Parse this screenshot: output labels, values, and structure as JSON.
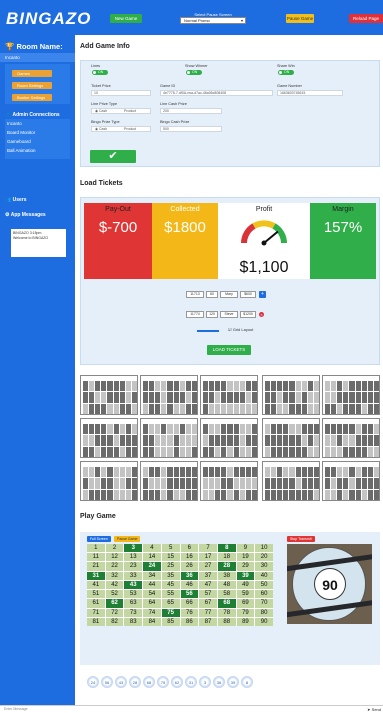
{
  "app": {
    "logo": "BINGAZO"
  },
  "topbar": {
    "new_game": "New Game",
    "pause_label": "Select Pause Screen",
    "pause_value": "Normal Promo",
    "pause_game": "Pause Game",
    "reload": "Reload Page"
  },
  "sidebar": {
    "room_title": "Room Name:",
    "room_name": "Incanto",
    "buttons": [
      "Games",
      "Room Settings",
      "Bunker Settings"
    ],
    "admin_header": "Admin Connections",
    "admin_links": [
      "Incanto",
      "Board Monitor",
      "Gameboard",
      "Ball Animation"
    ],
    "users_header": "Users",
    "messages_header": "App Messages",
    "message_from": "BINGAZO 3:15pm",
    "message_text": "Welcome to BINGAZO"
  },
  "game_info": {
    "title": "Add Game Info",
    "lines_label": "Lines",
    "lines_toggle": "ON",
    "show_winner_label": "Show Winner",
    "show_winner_toggle": "ON",
    "share_win_label": "Share Win",
    "share_win_toggle": "ON",
    "ticket_price_label": "Ticket Price",
    "ticket_price_value": "10",
    "game_id_label": "Game ID",
    "game_id_value": "4e7775-7-df0A-nsa-d7ac-46a06c808408",
    "game_number_label": "Game Number",
    "game_number_value": "1663603745615",
    "line_prize_type_label": "Line Prize Type",
    "line_prize_cash": "Cash",
    "line_prize_product": "Product",
    "line_cash_prize_label": "Line Cash Prize",
    "line_cash_prize_value": "200",
    "bingo_prize_type_label": "Bingo Prize Type",
    "bingo_prize_cash": "Cash",
    "bingo_prize_product": "Product",
    "bingo_cash_prize_label": "Bingo Cash Prize",
    "bingo_cash_prize_value": "500",
    "submit_icon": "checkmark-icon"
  },
  "load_tickets": {
    "title": "Load Tickets",
    "payout_label": "Pay-Out",
    "payout_value": "$-700",
    "collected_label": "Collected",
    "collected_value": "$1800",
    "profit_label": "Profit",
    "profit_value": "$1,100",
    "profit_gauge_fraction": 0.78,
    "margin_label": "Margin",
    "margin_value": "157%",
    "colors": {
      "payout": "#e03535",
      "collected": "#f3b817",
      "margin": "#2fae4a"
    },
    "row1": {
      "start": "11713",
      "count": "60",
      "name": "Mary",
      "amount": "$600"
    },
    "row2": {
      "start": "11774",
      "count": "120",
      "name": "Steve",
      "amount": "$1200"
    },
    "grid_layout_label": "Grid Layout",
    "load_button": "LOAD TICKETS"
  },
  "play": {
    "title": "Play Game",
    "full_screen": "Full Screen",
    "pause_game": "Pause Game",
    "stop_transmit": "Stop Transmit",
    "numbers": [
      1,
      2,
      3,
      4,
      5,
      6,
      7,
      8,
      9,
      10,
      11,
      12,
      13,
      14,
      15,
      16,
      17,
      18,
      19,
      20,
      21,
      22,
      23,
      24,
      25,
      26,
      27,
      28,
      29,
      30,
      31,
      32,
      33,
      34,
      35,
      36,
      37,
      38,
      39,
      40,
      41,
      42,
      43,
      44,
      45,
      46,
      47,
      48,
      49,
      50,
      51,
      52,
      53,
      54,
      55,
      56,
      57,
      58,
      59,
      60,
      61,
      62,
      63,
      64,
      65,
      66,
      67,
      68,
      69,
      70,
      71,
      72,
      73,
      74,
      75,
      76,
      77,
      78,
      79,
      80,
      81,
      82,
      83,
      84,
      85,
      86,
      87,
      88,
      89,
      90
    ],
    "called": [
      3,
      8,
      24,
      28,
      31,
      36,
      39,
      43,
      56,
      62,
      68,
      75
    ],
    "current_ball": "90",
    "recent_balls": [
      "24",
      "56",
      "43",
      "28",
      "68",
      "75",
      "62",
      "31",
      "3",
      "36",
      "39",
      "8"
    ]
  },
  "chat": {
    "placeholder": "Enter Message",
    "send": "Send"
  }
}
